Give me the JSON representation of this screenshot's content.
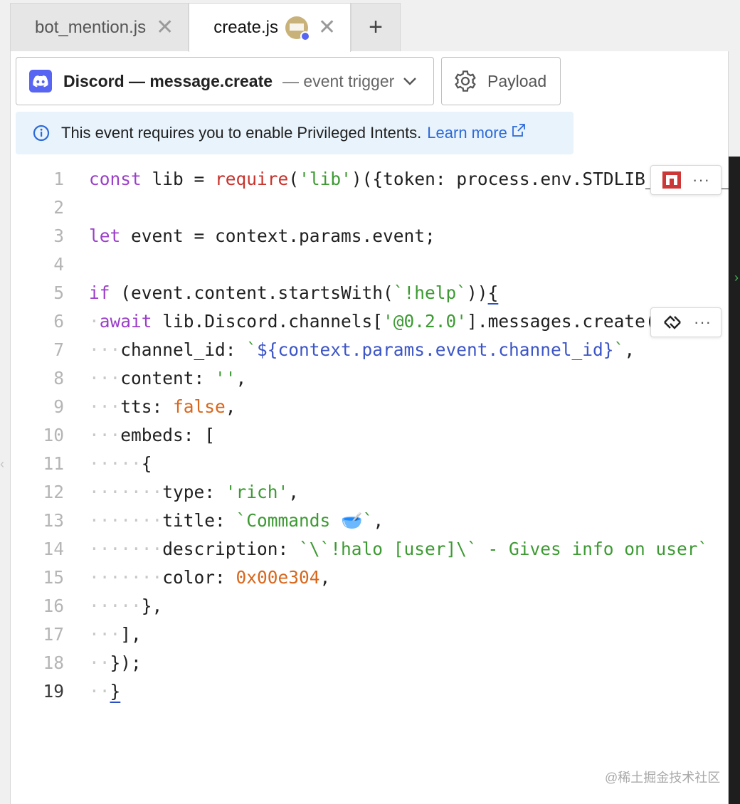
{
  "tabs": [
    {
      "label": "bot_mention.js"
    },
    {
      "label": "create.js"
    }
  ],
  "trigger": {
    "name": "Discord — message.create",
    "sub": "— event trigger"
  },
  "payload_label": "Payload",
  "info": {
    "text": "This event requires you to enable Privileged Intents.",
    "link": "Learn more"
  },
  "code_lines": [
    {
      "n": "1",
      "tokens": [
        [
          "kw",
          "const"
        ],
        [
          "",
          "lib = "
        ],
        [
          "fn",
          "require"
        ],
        [
          "",
          "("
        ],
        [
          "str",
          "'lib'"
        ],
        [
          "",
          ")({token: process.env.STDLIB_SECRET_TOKEN});"
        ]
      ]
    },
    {
      "n": "2",
      "tokens": []
    },
    {
      "n": "3",
      "tokens": [
        [
          "kw",
          "let"
        ],
        [
          "",
          "event = context.params.event;"
        ]
      ]
    },
    {
      "n": "4",
      "tokens": []
    },
    {
      "n": "5",
      "tokens": [
        [
          "kw",
          "if"
        ],
        [
          "",
          " (event.content.startsWith("
        ],
        [
          "str",
          "`!help`"
        ],
        [
          "",
          "))"
        ],
        [
          "ul",
          "{"
        ]
      ]
    },
    {
      "n": "6",
      "tokens": [
        [
          "ws",
          "·"
        ],
        [
          "kw",
          "await"
        ],
        [
          "",
          " lib.Discord.channels["
        ],
        [
          "str",
          "'@0.2.0'"
        ],
        [
          "",
          "].messages.create({"
        ]
      ]
    },
    {
      "n": "7",
      "tokens": [
        [
          "ws",
          "···"
        ],
        [
          "",
          "channel_id: "
        ],
        [
          "str",
          "`"
        ],
        [
          "tpl",
          "${context.params.event.channel_id}"
        ],
        [
          "str",
          "`"
        ],
        [
          "",
          ","
        ]
      ]
    },
    {
      "n": "8",
      "tokens": [
        [
          "ws",
          "···"
        ],
        [
          "",
          "content: "
        ],
        [
          "str",
          "''"
        ],
        [
          "",
          ","
        ]
      ]
    },
    {
      "n": "9",
      "tokens": [
        [
          "ws",
          "···"
        ],
        [
          "",
          "tts: "
        ],
        [
          "num",
          "false"
        ],
        [
          "",
          ","
        ]
      ]
    },
    {
      "n": "10",
      "tokens": [
        [
          "ws",
          "···"
        ],
        [
          "",
          "embeds: ["
        ]
      ]
    },
    {
      "n": "11",
      "tokens": [
        [
          "ws",
          "·····"
        ],
        [
          "",
          "{"
        ]
      ]
    },
    {
      "n": "12",
      "tokens": [
        [
          "ws",
          "·······"
        ],
        [
          "",
          "type: "
        ],
        [
          "str",
          "'rich'"
        ],
        [
          "",
          ","
        ]
      ]
    },
    {
      "n": "13",
      "tokens": [
        [
          "ws",
          "·······"
        ],
        [
          "",
          "title: "
        ],
        [
          "str",
          "`Commands "
        ],
        [
          "emo",
          "🥣"
        ],
        [
          "str",
          "`"
        ],
        [
          "",
          ","
        ]
      ]
    },
    {
      "n": "14",
      "tokens": [
        [
          "ws",
          "·······"
        ],
        [
          "",
          "description: "
        ],
        [
          "str",
          "`\\`!halo [user]\\` - Gives info on user`"
        ]
      ]
    },
    {
      "n": "15",
      "tokens": [
        [
          "ws",
          "·······"
        ],
        [
          "",
          "color: "
        ],
        [
          "num",
          "0x00e304"
        ],
        [
          "",
          ","
        ]
      ]
    },
    {
      "n": "16",
      "tokens": [
        [
          "ws",
          "·····"
        ],
        [
          "",
          "},"
        ]
      ]
    },
    {
      "n": "17",
      "tokens": [
        [
          "ws",
          "···"
        ],
        [
          "",
          "],"
        ]
      ]
    },
    {
      "n": "18",
      "tokens": [
        [
          "ws",
          "··"
        ],
        [
          "",
          "});"
        ]
      ]
    },
    {
      "n": "19",
      "tokens": [
        [
          "ws",
          "··"
        ],
        [
          "ul",
          "}"
        ]
      ]
    }
  ],
  "current_line": "19",
  "icons": {
    "discord": "discord-logo-icon",
    "gear": "gear-icon",
    "info": "info-circle-icon",
    "external": "external-link-icon",
    "npm": "npm-icon",
    "api": "api-node-icon",
    "more": "more-dots-icon"
  },
  "widget_more": "···",
  "watermark": "@稀土掘金技术社区"
}
